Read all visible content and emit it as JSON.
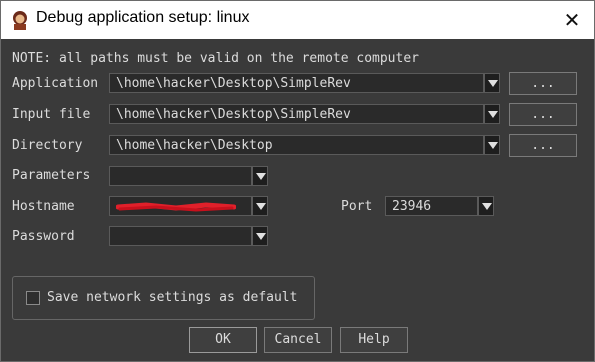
{
  "window": {
    "title": "Debug application setup: linux",
    "close_glyph": "✕"
  },
  "note": "NOTE: all paths must be valid on the remote computer",
  "fields": {
    "application": {
      "label": "Application",
      "value": "\\home\\hacker\\Desktop\\SimpleRev",
      "browse": "..."
    },
    "input_file": {
      "label": "Input file",
      "value": "\\home\\hacker\\Desktop\\SimpleRev",
      "browse": "..."
    },
    "directory": {
      "label": "Directory",
      "value": "\\home\\hacker\\Desktop",
      "browse": "..."
    },
    "parameters": {
      "label": "Parameters",
      "value": ""
    },
    "hostname": {
      "label": "Hostname",
      "value": ""
    },
    "port": {
      "label": "Port",
      "value": "23946"
    },
    "password": {
      "label": "Password",
      "value": ""
    }
  },
  "save_default": {
    "label": "Save network settings as default",
    "checked": false
  },
  "buttons": {
    "ok": "OK",
    "cancel": "Cancel",
    "help": "Help"
  },
  "colors": {
    "accent_redaction": "#e0202a"
  },
  "icons": {
    "app": "ida-user-icon",
    "dropdown": "chevron-down-icon"
  }
}
